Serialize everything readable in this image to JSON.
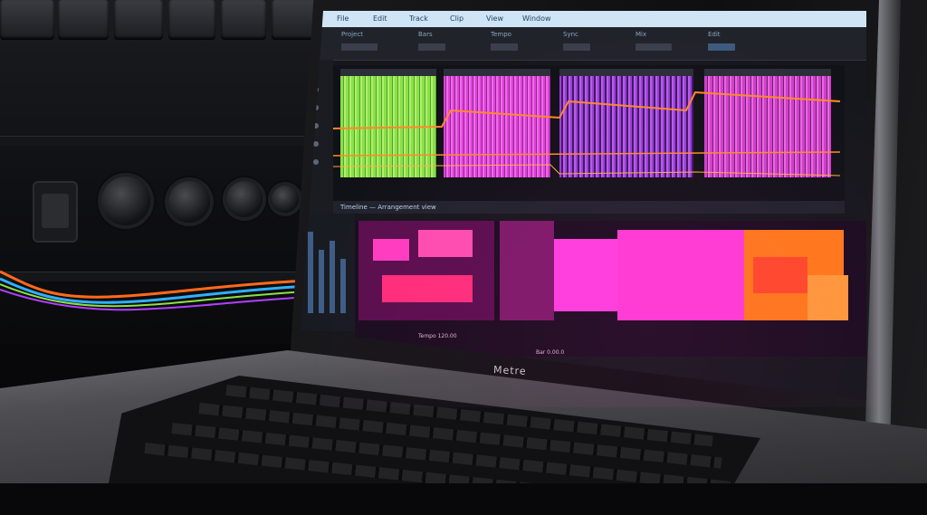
{
  "device": {
    "brand_text": "Metre"
  },
  "daw": {
    "menubar_items": [
      "File",
      "Edit",
      "Track",
      "Clip",
      "View",
      "Window"
    ],
    "toolbar_labels": [
      "Project",
      "Bars",
      "Tempo",
      "Sync",
      "Mix",
      "Edit"
    ],
    "info_text": "Timeline — Arrangement view",
    "status_left": "Tempo 120.00",
    "status_right": "Bar 0.00.0"
  },
  "colors": {
    "accent_green": "#8be04a",
    "accent_magenta": "#e040d8",
    "accent_purple": "#9a3ed8",
    "accent_orange": "#ff6a1a",
    "menubar": "#cfe4f4"
  }
}
